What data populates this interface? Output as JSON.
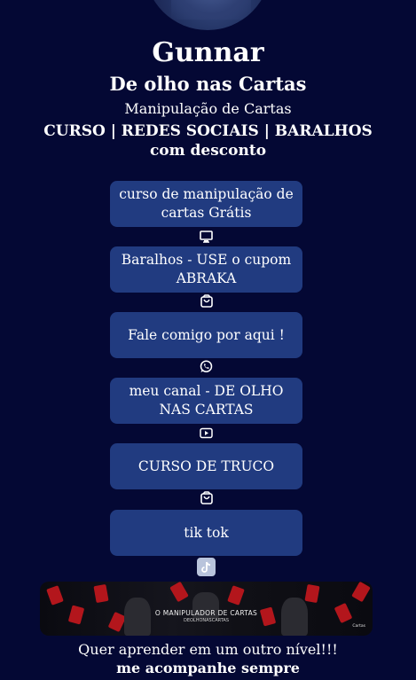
{
  "profile": {
    "name": "Gunnar",
    "subtitle": "De olho nas Cartas",
    "tagline": "Manipulação de Cartas",
    "headline_line1": "CURSO | REDES SOCIAIS | BARALHOS",
    "headline_line2": "com desconto"
  },
  "links": [
    {
      "label": "curso de manipulação de cartas Grátis",
      "icon": "monitor-icon"
    },
    {
      "label": "Baralhos - USE o cupom ABRAKA",
      "icon": "shopping-bag-icon"
    },
    {
      "label": "Fale comigo por aqui !",
      "icon": "whatsapp-icon"
    },
    {
      "label": "meu canal - DE OLHO NAS CARTAS",
      "icon": "youtube-icon"
    },
    {
      "label": "CURSO DE TRUCO",
      "icon": "shopping-bag-icon"
    },
    {
      "label": "tik tok",
      "icon": "tiktok-icon"
    }
  ],
  "banner": {
    "title": "O MANIPULADOR DE CARTAS",
    "subtitle": "DEOLHONASCARTAS",
    "badge": "Cartas"
  },
  "footer": {
    "line1": "Quer aprender em um outro nível!!!",
    "line2": "me acompanhe sempre"
  },
  "colors": {
    "background": "#040834",
    "button": "#213b80",
    "text": "#ffffff"
  }
}
